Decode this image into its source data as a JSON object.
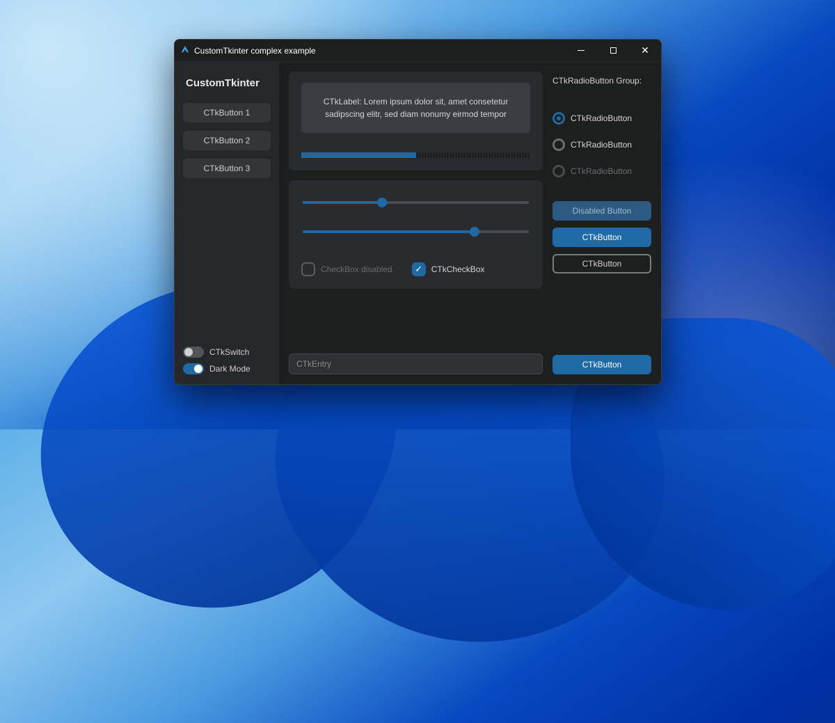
{
  "window": {
    "title": "CustomTkinter complex example"
  },
  "sidebar": {
    "logo": "CustomTkinter",
    "buttons": [
      "CTkButton 1",
      "CTkButton 2",
      "CTkButton 3"
    ],
    "switch1": {
      "label": "CTkSwitch",
      "on": false
    },
    "switch2": {
      "label": "Dark Mode",
      "on": true
    }
  },
  "main": {
    "label_text": "CTkLabel: Lorem ipsum dolor sit, amet consetetur sadipscing elitr, sed diam nonumy eirmod tempor",
    "progress_pct": 50,
    "slider1_pct": 35,
    "slider2_pct": 76,
    "checkbox_disabled_label": "CheckBox disabled",
    "checkbox_enabled_label": "CTkCheckBox",
    "entry_placeholder": "CTkEntry"
  },
  "right": {
    "group_label": "CTkRadioButton Group:",
    "radios": [
      {
        "label": "CTkRadioButton",
        "state": "selected"
      },
      {
        "label": "CTkRadioButton",
        "state": "normal"
      },
      {
        "label": "CTkRadioButton",
        "state": "disabled"
      }
    ],
    "btn_disabled": "Disabled Button",
    "btn_normal": "CTkButton",
    "btn_outline": "CTkButton",
    "btn_bottom": "CTkButton"
  },
  "colors": {
    "accent": "#1f6aa5",
    "bg_window": "#1d1e1e",
    "bg_sidebar": "#262729",
    "bg_card": "#2a2b2e"
  }
}
